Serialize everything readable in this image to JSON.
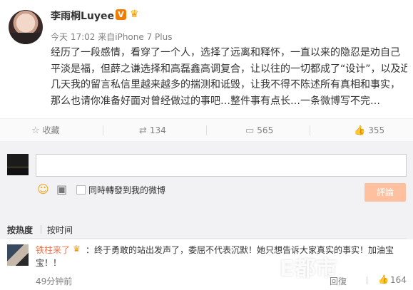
{
  "post": {
    "username": "李雨桐Luyee",
    "verified_badge": "V",
    "member_icon": "member-crown",
    "time": "今天 17:02",
    "source_prefix": "来自",
    "source": "iPhone 7 Plus",
    "lines": [
      "经历了一段感情，看穿了一个人，选择了远离和释怀，一直以来的隐忍是劝自己",
      "平淡是福，但薛之谦选择和高磊鑫高调复合，让以往的一切都成了“设计”，以及近",
      "几天我的留言私信里越来越多的揣测和诋毁，让我不得不陈述所有真相和事实，",
      "那么也请你准备好面对曾经做过的事吧…整件事有点长…一条微博写不完…"
    ]
  },
  "actions": [
    {
      "icon": "star-icon",
      "glyph": "☆",
      "label": "收藏"
    },
    {
      "icon": "repost-icon",
      "glyph": "⇄",
      "label": "134"
    },
    {
      "icon": "comment-icon",
      "glyph": "▭",
      "label": "565"
    },
    {
      "icon": "like-icon",
      "glyph": "👍",
      "label": "355"
    }
  ],
  "compose": {
    "repost_label": "同時轉發到我的微博",
    "submit_label": "評論"
  },
  "sort": {
    "hot": "按热度",
    "time": "按时间"
  },
  "comment": {
    "user": "铁柱来了",
    "text": "：终于勇敢的站出发声了，委屈不代表沉默！她只想告诉大家真实的事实！加油宝宝！！",
    "time": "49分钟前",
    "reply": "回復",
    "likes": "164"
  },
  "watermark": "E都市",
  "colors": {
    "accent": "#eb7350",
    "verified": "#f07c06",
    "button": "#ffc09f"
  }
}
